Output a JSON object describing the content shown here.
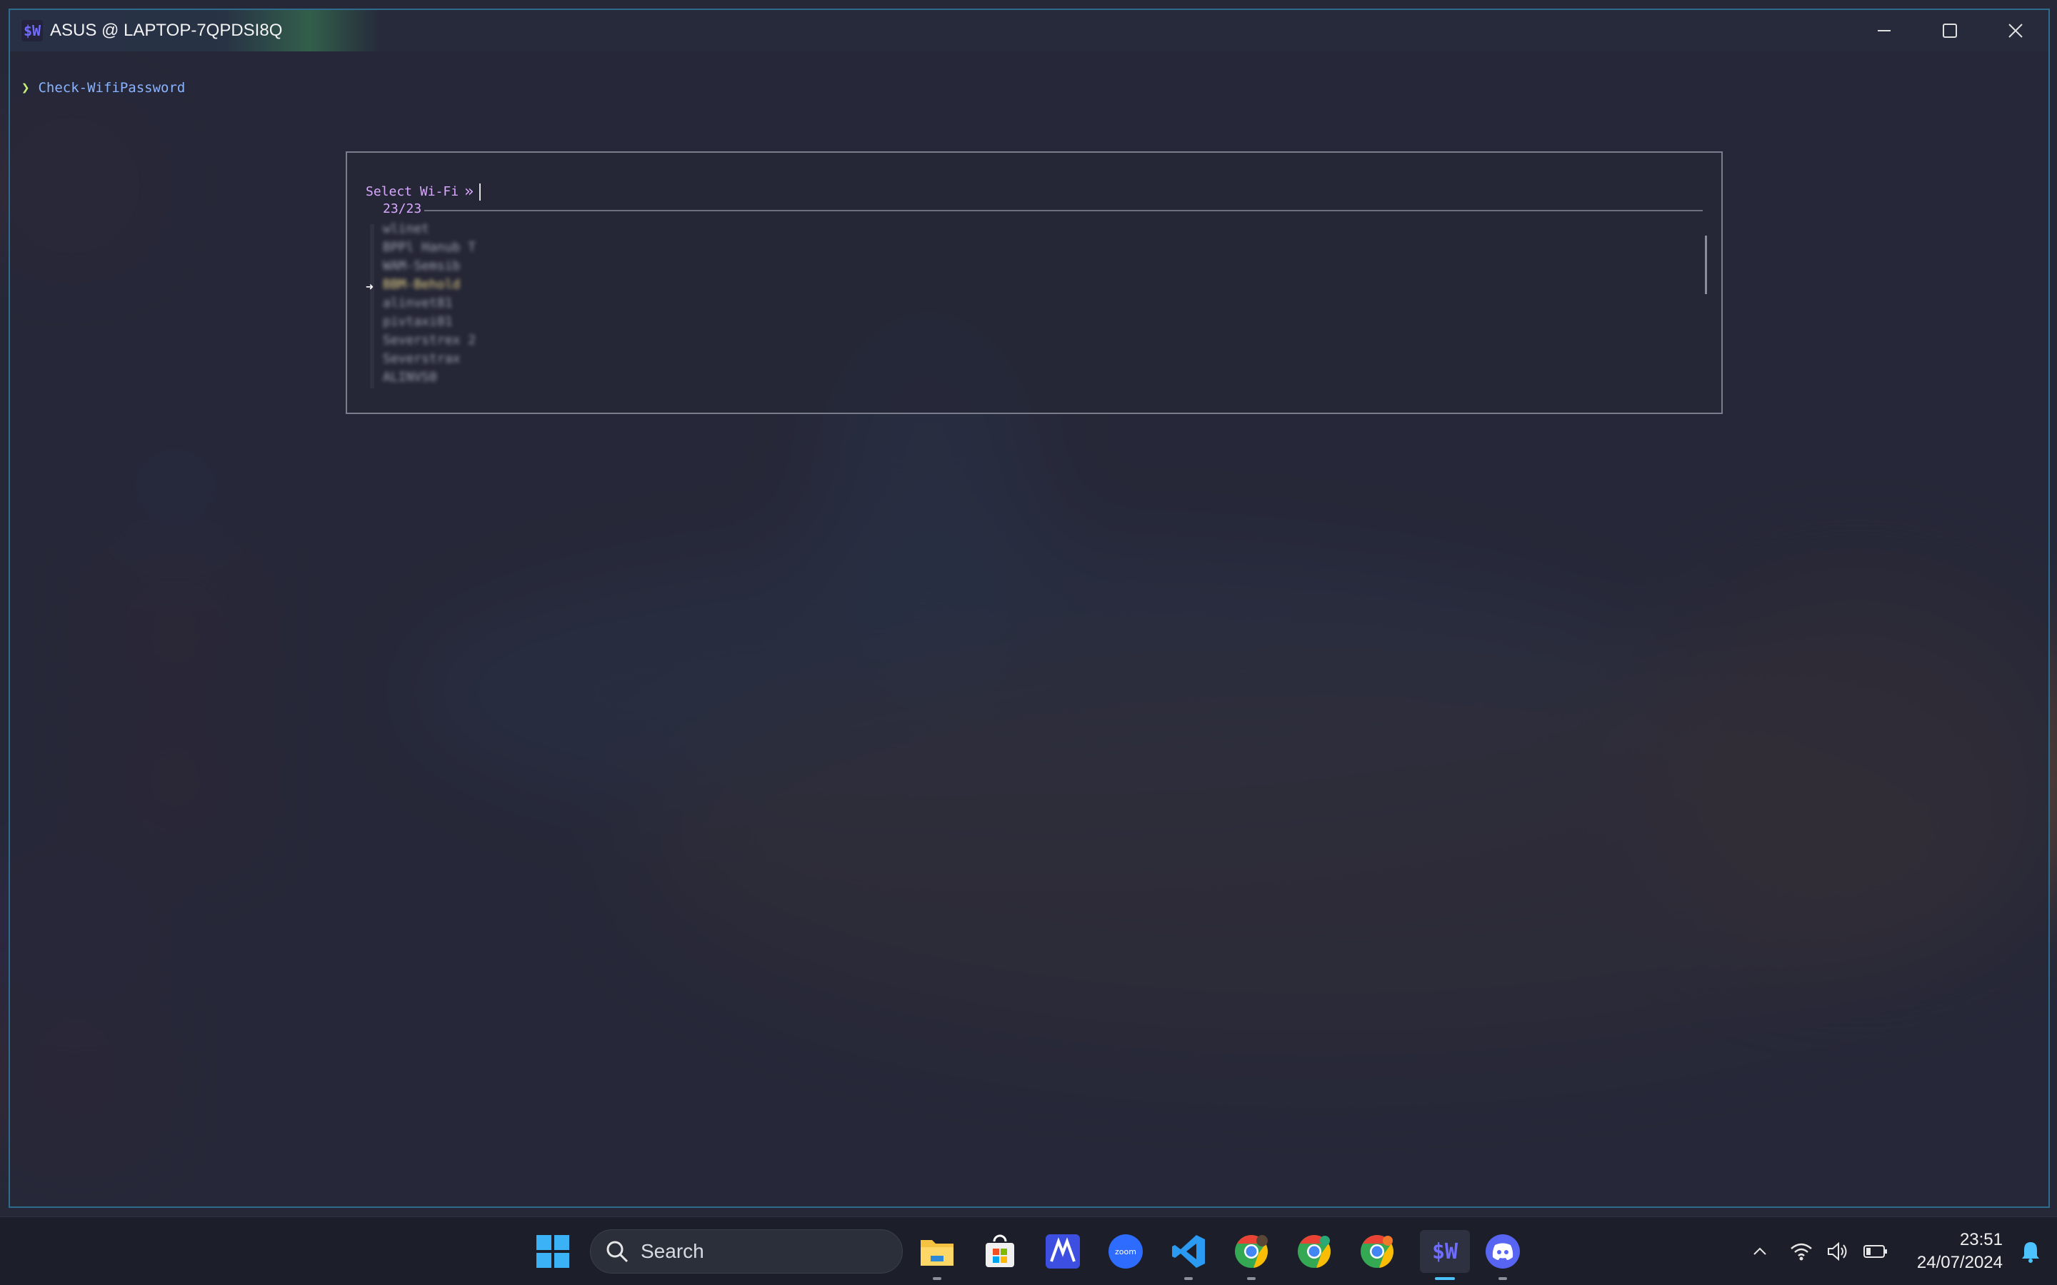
{
  "window": {
    "title": "ASUS @ LAPTOP-7QPDSI8Q",
    "app_icon_text": "$W",
    "controls": [
      "minimize-icon",
      "maximize-icon",
      "close-icon"
    ]
  },
  "terminal": {
    "prompt_symbol": "❯",
    "command": "Check-WifiPassword"
  },
  "picker": {
    "label": "Select Wi-Fi",
    "label_suffix": "»",
    "count": "23/23",
    "pointer": "➜",
    "items": [
      "wlinet",
      "BPPl Hanub T",
      "WAM-Semsib",
      "BBM-Behold",
      "alinvet81",
      "pivtaxi01",
      "Severstrex 2",
      "Severstrax",
      "ALINVS0"
    ],
    "selected_index": 3
  },
  "taskbar": {
    "search_placeholder": "Search",
    "apps": [
      "windows-start-icon",
      "file-explorer-icon",
      "microsoft-store-icon",
      "marvel-app-icon",
      "zoom-icon",
      "vscode-icon",
      "chrome-icon",
      "chrome-icon",
      "chrome-icon",
      "terminal-icon",
      "discord-icon"
    ],
    "zoom_label": "zoom",
    "terminal_label": "$W",
    "time": "23:51",
    "date": "24/07/2024"
  },
  "colors": {
    "accent": "#4cc2ff",
    "prompt": "#8ab4ff",
    "picker_label": "#d9a8ff",
    "selected_item": "#e8d488"
  }
}
